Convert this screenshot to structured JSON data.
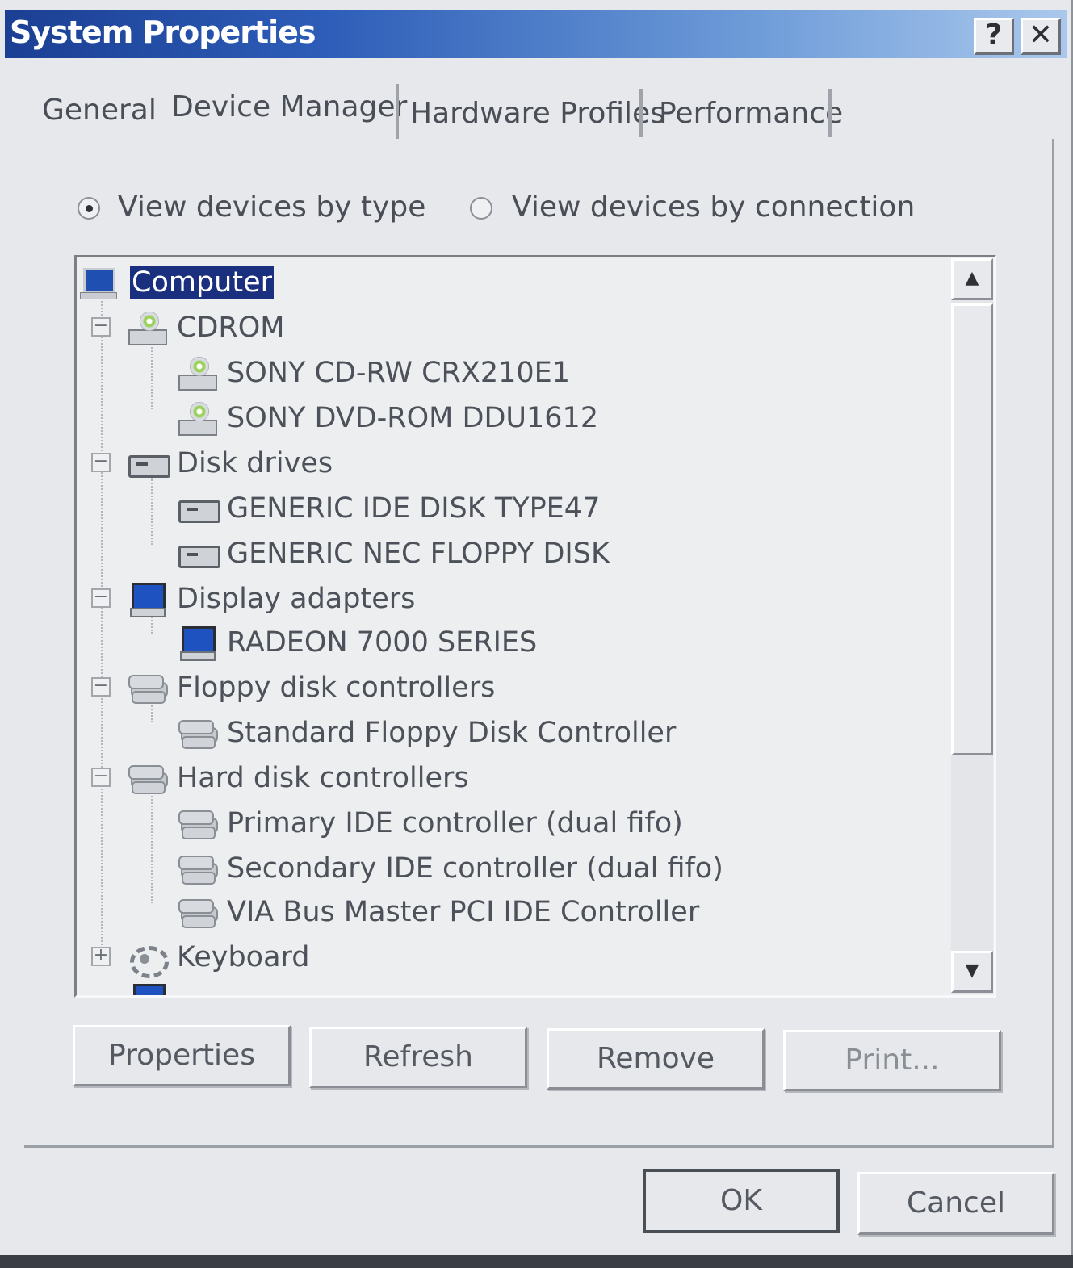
{
  "window": {
    "title": "System Properties",
    "help_label": "?",
    "close_label": "✕"
  },
  "tabs": [
    "General",
    "Device Manager",
    "Hardware Profiles",
    "Performance"
  ],
  "view_options": {
    "by_type": "View devices by type",
    "by_connection": "View devices by connection",
    "selected": "by_type"
  },
  "tree": {
    "root": "Computer",
    "categories": [
      {
        "label": "CDROM",
        "expander": "−",
        "icon": "cdrom-icon",
        "children": [
          "SONY CD-RW  CRX210E1",
          "SONY DVD-ROM DDU1612"
        ]
      },
      {
        "label": "Disk drives",
        "expander": "−",
        "icon": "disk-drive-icon",
        "children": [
          "GENERIC IDE  DISK TYPE47",
          "GENERIC NEC  FLOPPY DISK"
        ]
      },
      {
        "label": "Display adapters",
        "expander": "−",
        "icon": "display-adapter-icon",
        "children": [
          "RADEON 7000 SERIES"
        ]
      },
      {
        "label": "Floppy disk controllers",
        "expander": "−",
        "icon": "controller-icon",
        "children": [
          "Standard Floppy Disk Controller"
        ]
      },
      {
        "label": "Hard disk controllers",
        "expander": "−",
        "icon": "controller-icon",
        "children": [
          "Primary IDE controller (dual fifo)",
          "Secondary IDE controller (dual fifo)",
          "VIA Bus Master PCI IDE Controller"
        ]
      },
      {
        "label": "Keyboard",
        "expander": "+",
        "icon": "keyboard-icon",
        "children": []
      }
    ]
  },
  "buttons": {
    "properties": "Properties",
    "refresh": "Refresh",
    "remove": "Remove",
    "print": "Print...",
    "ok": "OK",
    "cancel": "Cancel"
  },
  "colors": {
    "titlebar": "#1b3f93",
    "selection": "#1a2f7d"
  }
}
